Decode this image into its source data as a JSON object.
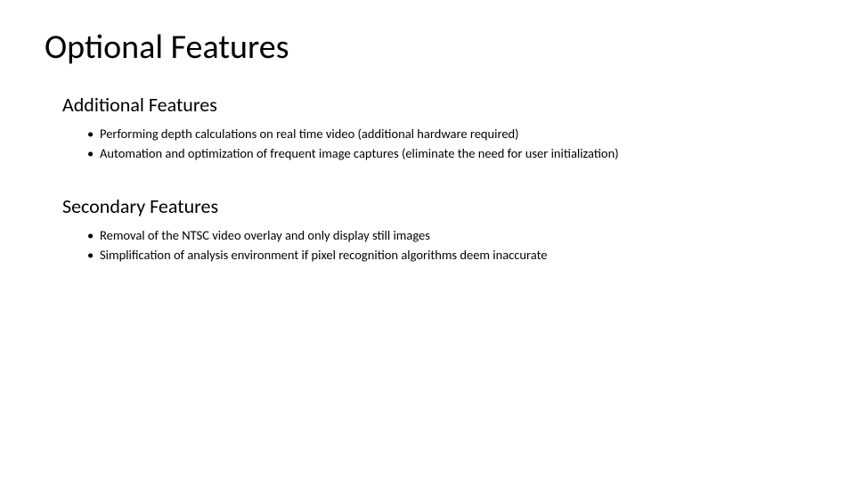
{
  "title": "Optional Features",
  "sections": [
    {
      "heading": "Additional Features",
      "bullets": [
        "Performing depth calculations on real time video (additional hardware required)",
        "Automation and optimization of frequent image captures (eliminate the need for user initialization)"
      ]
    },
    {
      "heading": "Secondary Features",
      "bullets": [
        "Removal of the NTSC video overlay and only display still images",
        "Simplification of analysis environment if pixel recognition algorithms deem inaccurate"
      ]
    }
  ]
}
